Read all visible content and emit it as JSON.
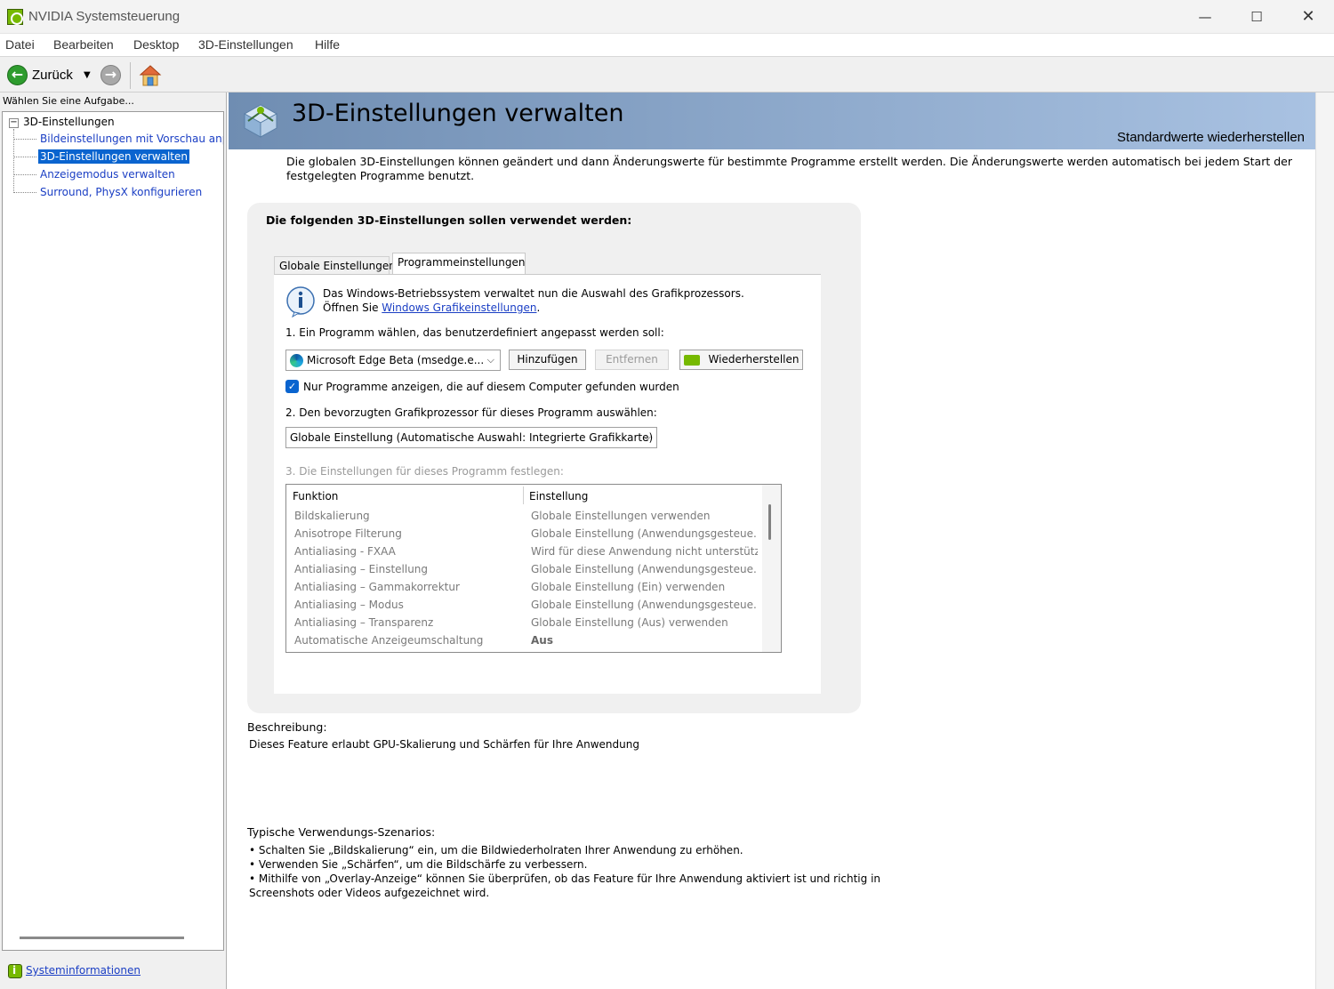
{
  "window": {
    "title": "NVIDIA Systemsteuerung",
    "minimize": "—",
    "maximize": "☐",
    "close": "✕"
  },
  "menu": [
    "Datei",
    "Bearbeiten",
    "Desktop",
    "3D-Einstellungen",
    "Hilfe"
  ],
  "toolbar": {
    "back_label": "Zurück",
    "back_glyph": "←",
    "forward_glyph": "→",
    "dropdown_glyph": "▼"
  },
  "sidebar": {
    "task_prompt": "Wählen Sie eine Aufgabe...",
    "root": "3D-Einstellungen",
    "expander": "−",
    "items": [
      {
        "label": "Bildeinstellungen mit Vorschau anpassen"
      },
      {
        "label": "3D-Einstellungen verwalten",
        "selected": true
      },
      {
        "label": "Anzeigemodus verwalten"
      },
      {
        "label": "Surround, PhysX konfigurieren"
      }
    ],
    "sysinfo_link": "Systeminformationen"
  },
  "page": {
    "title": "3D-Einstellungen verwalten",
    "restore_defaults": "Standardwerte wiederherstellen",
    "intro": "Die globalen 3D-Einstellungen können geändert und dann Änderungswerte für bestimmte Programme erstellt werden. Die Änderungswerte werden automatisch bei jedem Start der festgelegten Programme benutzt.",
    "panel_title": "Die folgenden 3D-Einstellungen sollen verwendet werden:",
    "tabs": [
      {
        "label": "Globale Einstellungen"
      },
      {
        "label": "Programmeinstellungen",
        "active": true
      }
    ],
    "info_line1": "Das Windows-Betriebssystem verwaltet nun die Auswahl des Grafikprozessors.",
    "info_line2_prefix": "Öffnen Sie ",
    "info_link": "Windows Grafikeinstellungen",
    "info_line2_suffix": ".",
    "step1": "1. Ein Programm wählen, das benutzerdefiniert angepasst werden soll:",
    "program_select": "Microsoft Edge Beta (msedge.e...",
    "add_button": "Hinzufügen",
    "remove_button": "Entfernen",
    "restore_button": "Wiederherstellen",
    "checkbox_checked": true,
    "checkbox_glyph": "✓",
    "checkbox_label": "Nur Programme anzeigen, die auf diesem Computer gefunden wurden",
    "step2": "2. Den bevorzugten Grafikprozessor für dieses Programm auswählen:",
    "gpu_select": "Globale Einstellung (Automatische Auswahl: Integrierte Grafikkarte)",
    "chevron": "⌵",
    "step3": "3. Die Einstellungen für dieses Programm festlegen:",
    "grid": {
      "headers": [
        "Funktion",
        "Einstellung"
      ],
      "rows": [
        [
          "Bildskalierung",
          "Globale Einstellungen verwenden"
        ],
        [
          "Anisotrope Filterung",
          "Globale Einstellung (Anwendungsgesteue..."
        ],
        [
          "Antialiasing - FXAA",
          "Wird für diese Anwendung nicht unterstützt"
        ],
        [
          "Antialiasing – Einstellung",
          "Globale Einstellung (Anwendungsgesteue..."
        ],
        [
          "Antialiasing – Gammakorrektur",
          "Globale Einstellung (Ein) verwenden"
        ],
        [
          "Antialiasing – Modus",
          "Globale Einstellung (Anwendungsgesteue..."
        ],
        [
          "Antialiasing – Transparenz",
          "Globale Einstellung (Aus) verwenden"
        ],
        [
          "Automatische Anzeigeumschaltung",
          "Aus"
        ]
      ]
    },
    "description_label": "Beschreibung:",
    "description_text": "Dieses Feature erlaubt GPU-Skalierung und Schärfen für Ihre Anwendung",
    "usage_label": "Typische Verwendungs-Szenarios:",
    "usage_items": [
      "• Schalten Sie „Bildskalierung“ ein, um die Bildwiederholraten Ihrer Anwendung zu erhöhen.",
      "• Verwenden Sie „Schärfen“, um die Bildschärfe zu verbessern.",
      "• Mithilfe von „Overlay-Anzeige“ können Sie überprüfen, ob das Feature für Ihre Anwendung aktiviert ist und richtig in",
      "Screenshots oder Videos aufgezeichnet wird."
    ]
  },
  "colors": {
    "accent": "#0a64cf",
    "nvidia_green": "#76b900",
    "link": "#1a3ec4",
    "header_band_start": "#6f8db2",
    "header_band_end": "#a9c2e2"
  }
}
